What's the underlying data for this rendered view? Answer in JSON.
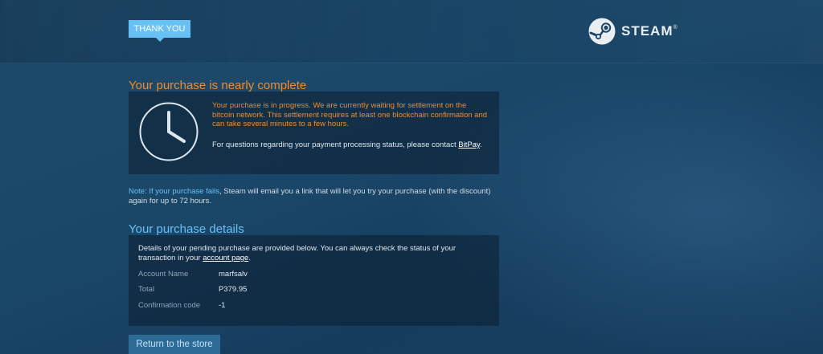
{
  "header": {
    "badge_label": "THANK YOU",
    "logo_text": "STEAM",
    "logo_mark": "®"
  },
  "status": {
    "title": "Your purchase is nearly complete",
    "icon": "clock-icon",
    "message": "Your purchase is in progress. We are currently waiting for settlement on the bitcoin network. This settlement requires at least one blockchain confirmation and can take several minutes to a few hours.",
    "contact_text": "For questions regarding your payment processing status, please contact ",
    "contact_link": "BitPay",
    "contact_suffix": "."
  },
  "note": {
    "prefix": "Note: If your purchase fails",
    "text": ", Steam will email you a link that will let you try your purchase (with the discount) again for up to 72 hours."
  },
  "details": {
    "title": "Your purchase details",
    "intro_text": "Details of your pending purchase are provided below. You can always check the status of your transaction in your ",
    "intro_link": "account page",
    "intro_suffix": ".",
    "rows": [
      {
        "label": "Account Name",
        "value": "marfsalv"
      },
      {
        "label": "Total",
        "value": "P379.95"
      },
      {
        "label": "Confirmation code",
        "value": "-1"
      }
    ]
  },
  "actions": {
    "return_label": "Return to the store"
  },
  "colors": {
    "accent_blue": "#67c1f5",
    "warning_orange": "#f08c2c",
    "button_bg": "#2d6a94"
  }
}
